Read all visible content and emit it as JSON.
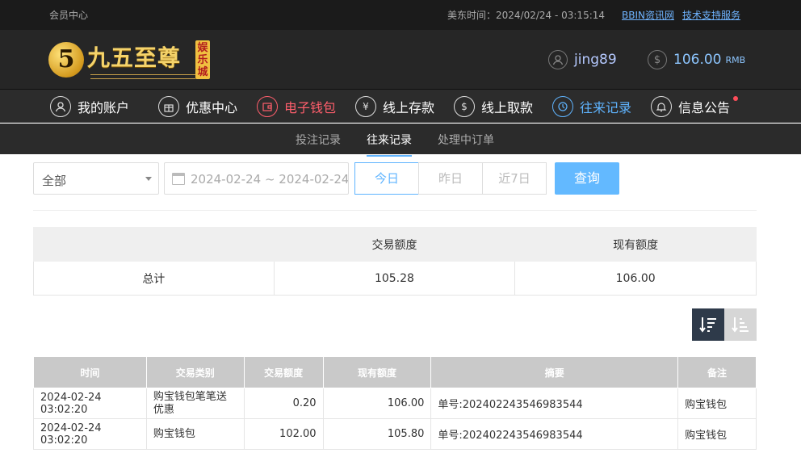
{
  "topbar": {
    "left": "会员中心",
    "time": "美东时间：2024/02/24 - 03:15:14",
    "link1": "BBIN资讯网",
    "link2": "技术支持服务"
  },
  "header": {
    "logo_mark": "5",
    "logo_text": "九五至尊",
    "logo_tag": "娱乐城",
    "username": "jing89",
    "balance": "106.00",
    "balance_unit": "RMB"
  },
  "nav": [
    {
      "label": "我的账户",
      "icon": "user-icon"
    },
    {
      "label": "优惠中心",
      "icon": "gift-icon"
    },
    {
      "label": "电子钱包",
      "icon": "wallet-icon"
    },
    {
      "label": "线上存款",
      "icon": "deposit-icon"
    },
    {
      "label": "线上取款",
      "icon": "withdraw-icon"
    },
    {
      "label": "往来记录",
      "icon": "records-icon"
    },
    {
      "label": "信息公告",
      "icon": "bell-icon"
    }
  ],
  "subnav": [
    "投注记录",
    "往来记录",
    "处理中订单"
  ],
  "filters": {
    "type_value": "全部",
    "date_range": "2024-02-24 ~ 2024-02-24",
    "today": "今日",
    "yesterday": "昨日",
    "last7": "近7日",
    "query": "查询"
  },
  "summary": {
    "col1": "交易额度",
    "col2": "现有额度",
    "row_label": "总计",
    "amount": "105.28",
    "current": "106.00"
  },
  "records": {
    "headers": [
      "时间",
      "交易类别",
      "交易额度",
      "现有额度",
      "摘要",
      "备注"
    ],
    "rows": [
      [
        "2024-02-24 03:02:20",
        "购宝钱包笔笔送优惠",
        "0.20",
        "106.00",
        "单号:202402243546983544",
        "购宝钱包"
      ],
      [
        "2024-02-24 03:02:20",
        "购宝钱包",
        "102.00",
        "105.80",
        "单号:202402243546983544",
        "购宝钱包"
      ]
    ]
  },
  "colors": {
    "accent_blue": "#63b9ff",
    "accent_red": "#ff5e6c",
    "dark_bg": "#262626"
  }
}
